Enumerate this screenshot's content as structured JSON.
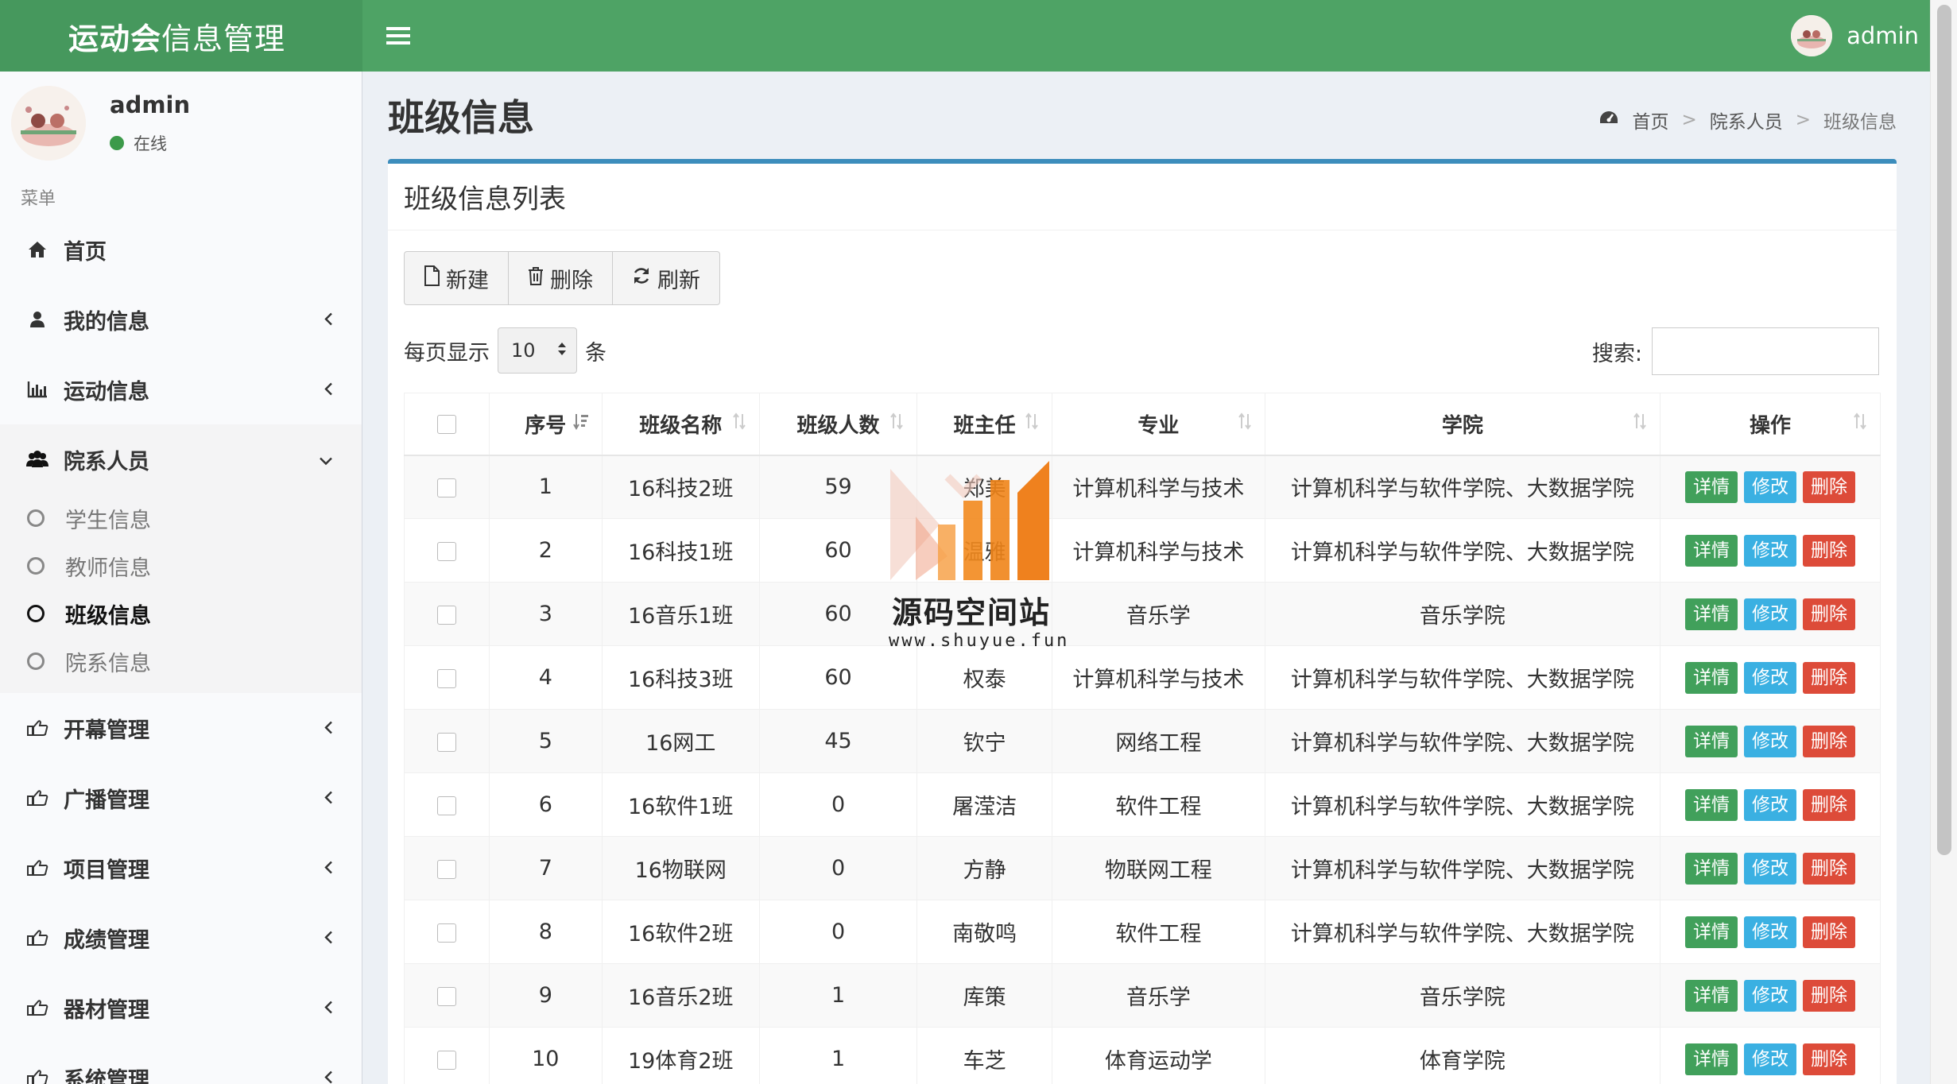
{
  "app": {
    "title_bold": "运动会",
    "title_rest": "信息管理",
    "user": "admin"
  },
  "sidebar": {
    "user_name": "admin",
    "status": "在线",
    "menu_header": "菜单",
    "items": [
      {
        "label": "首页"
      },
      {
        "label": "我的信息"
      },
      {
        "label": "运动信息"
      },
      {
        "label": "院系人员"
      },
      {
        "label": "开幕管理"
      },
      {
        "label": "广播管理"
      },
      {
        "label": "项目管理"
      },
      {
        "label": "成绩管理"
      },
      {
        "label": "器材管理"
      },
      {
        "label": "系统管理"
      }
    ],
    "sub_items": [
      {
        "label": "学生信息"
      },
      {
        "label": "教师信息"
      },
      {
        "label": "班级信息"
      },
      {
        "label": "院系信息"
      }
    ]
  },
  "page": {
    "title": "班级信息",
    "breadcrumb": [
      "首页",
      "院系人员",
      "班级信息"
    ],
    "box_title": "班级信息列表"
  },
  "toolbar": {
    "new_label": "新建",
    "delete_label": "删除",
    "refresh_label": "刷新"
  },
  "length": {
    "prefix": "每页显示",
    "value": "10",
    "suffix": "条"
  },
  "search": {
    "label": "搜索:",
    "placeholder": ""
  },
  "table": {
    "headers": [
      "序号",
      "班级名称",
      "班级人数",
      "班主任",
      "专业",
      "学院",
      "操作"
    ],
    "actions": {
      "detail": "详情",
      "edit": "修改",
      "delete": "删除"
    },
    "rows": [
      [
        "1",
        "16科技2班",
        "59",
        "郑美",
        "计算机科学与技术",
        "计算机科学与软件学院、大数据学院"
      ],
      [
        "2",
        "16科技1班",
        "60",
        "温雅",
        "计算机科学与技术",
        "计算机科学与软件学院、大数据学院"
      ],
      [
        "3",
        "16音乐1班",
        "60",
        "",
        "音乐学",
        "音乐学院"
      ],
      [
        "4",
        "16科技3班",
        "60",
        "权泰",
        "计算机科学与技术",
        "计算机科学与软件学院、大数据学院"
      ],
      [
        "5",
        "16网工",
        "45",
        "钦宁",
        "网络工程",
        "计算机科学与软件学院、大数据学院"
      ],
      [
        "6",
        "16软件1班",
        "0",
        "屠滢洁",
        "软件工程",
        "计算机科学与软件学院、大数据学院"
      ],
      [
        "7",
        "16物联网",
        "0",
        "方静",
        "物联网工程",
        "计算机科学与软件学院、大数据学院"
      ],
      [
        "8",
        "16软件2班",
        "0",
        "南敬鸣",
        "软件工程",
        "计算机科学与软件学院、大数据学院"
      ],
      [
        "9",
        "16音乐2班",
        "1",
        "库策",
        "音乐学",
        "音乐学院"
      ],
      [
        "10",
        "19体育2班",
        "1",
        "车芝",
        "体育运动学",
        "体育学院"
      ]
    ]
  },
  "watermark": {
    "text": "源码空间站",
    "url": "www.shuyue.fun"
  },
  "colors": {
    "header": "#4ea365",
    "accent": "#3c8dbc",
    "detail": "#41a05b",
    "edit": "#3ab0e2",
    "delete": "#dd4b39"
  }
}
